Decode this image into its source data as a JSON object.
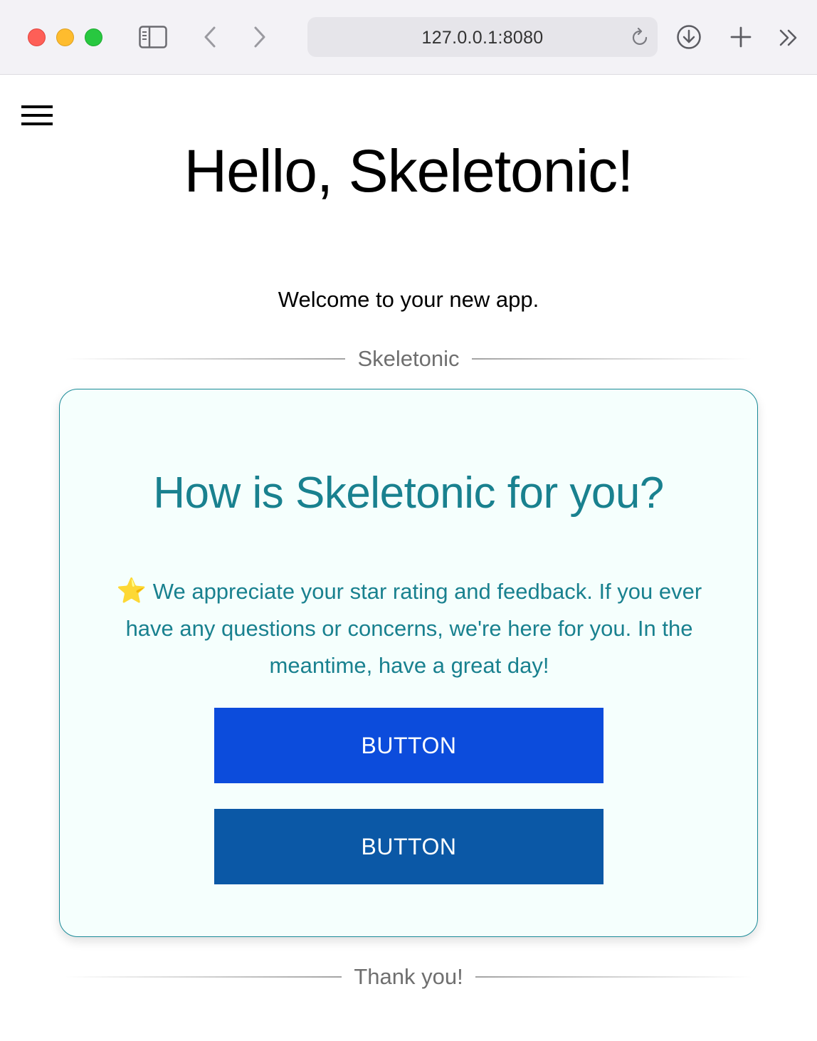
{
  "browser": {
    "url": "127.0.0.1:8080",
    "icons": [
      "sidebar-icon",
      "back-icon",
      "forward-icon",
      "reload-icon",
      "download-icon",
      "new-tab-icon",
      "more-icon"
    ]
  },
  "page": {
    "menu_icon": "hamburger-icon",
    "title": "Hello, Skeletonic!",
    "welcome": "Welcome to your new app.",
    "divider_top": "Skeletonic",
    "divider_bottom": "Thank you!"
  },
  "card": {
    "title": "How is Skeletonic for you?",
    "star": "⭐",
    "text": " We appreciate your star rating and feedback. If you ever have any questions or concerns, we're here for you. In the meantime, have a great day!",
    "button_primary": "BUTTON",
    "button_secondary": "BUTTON"
  },
  "colors": {
    "accent": "#19818f",
    "card_bg": "#f5fffd",
    "button_primary": "#0c4cdc",
    "button_secondary": "#0b58a6"
  }
}
